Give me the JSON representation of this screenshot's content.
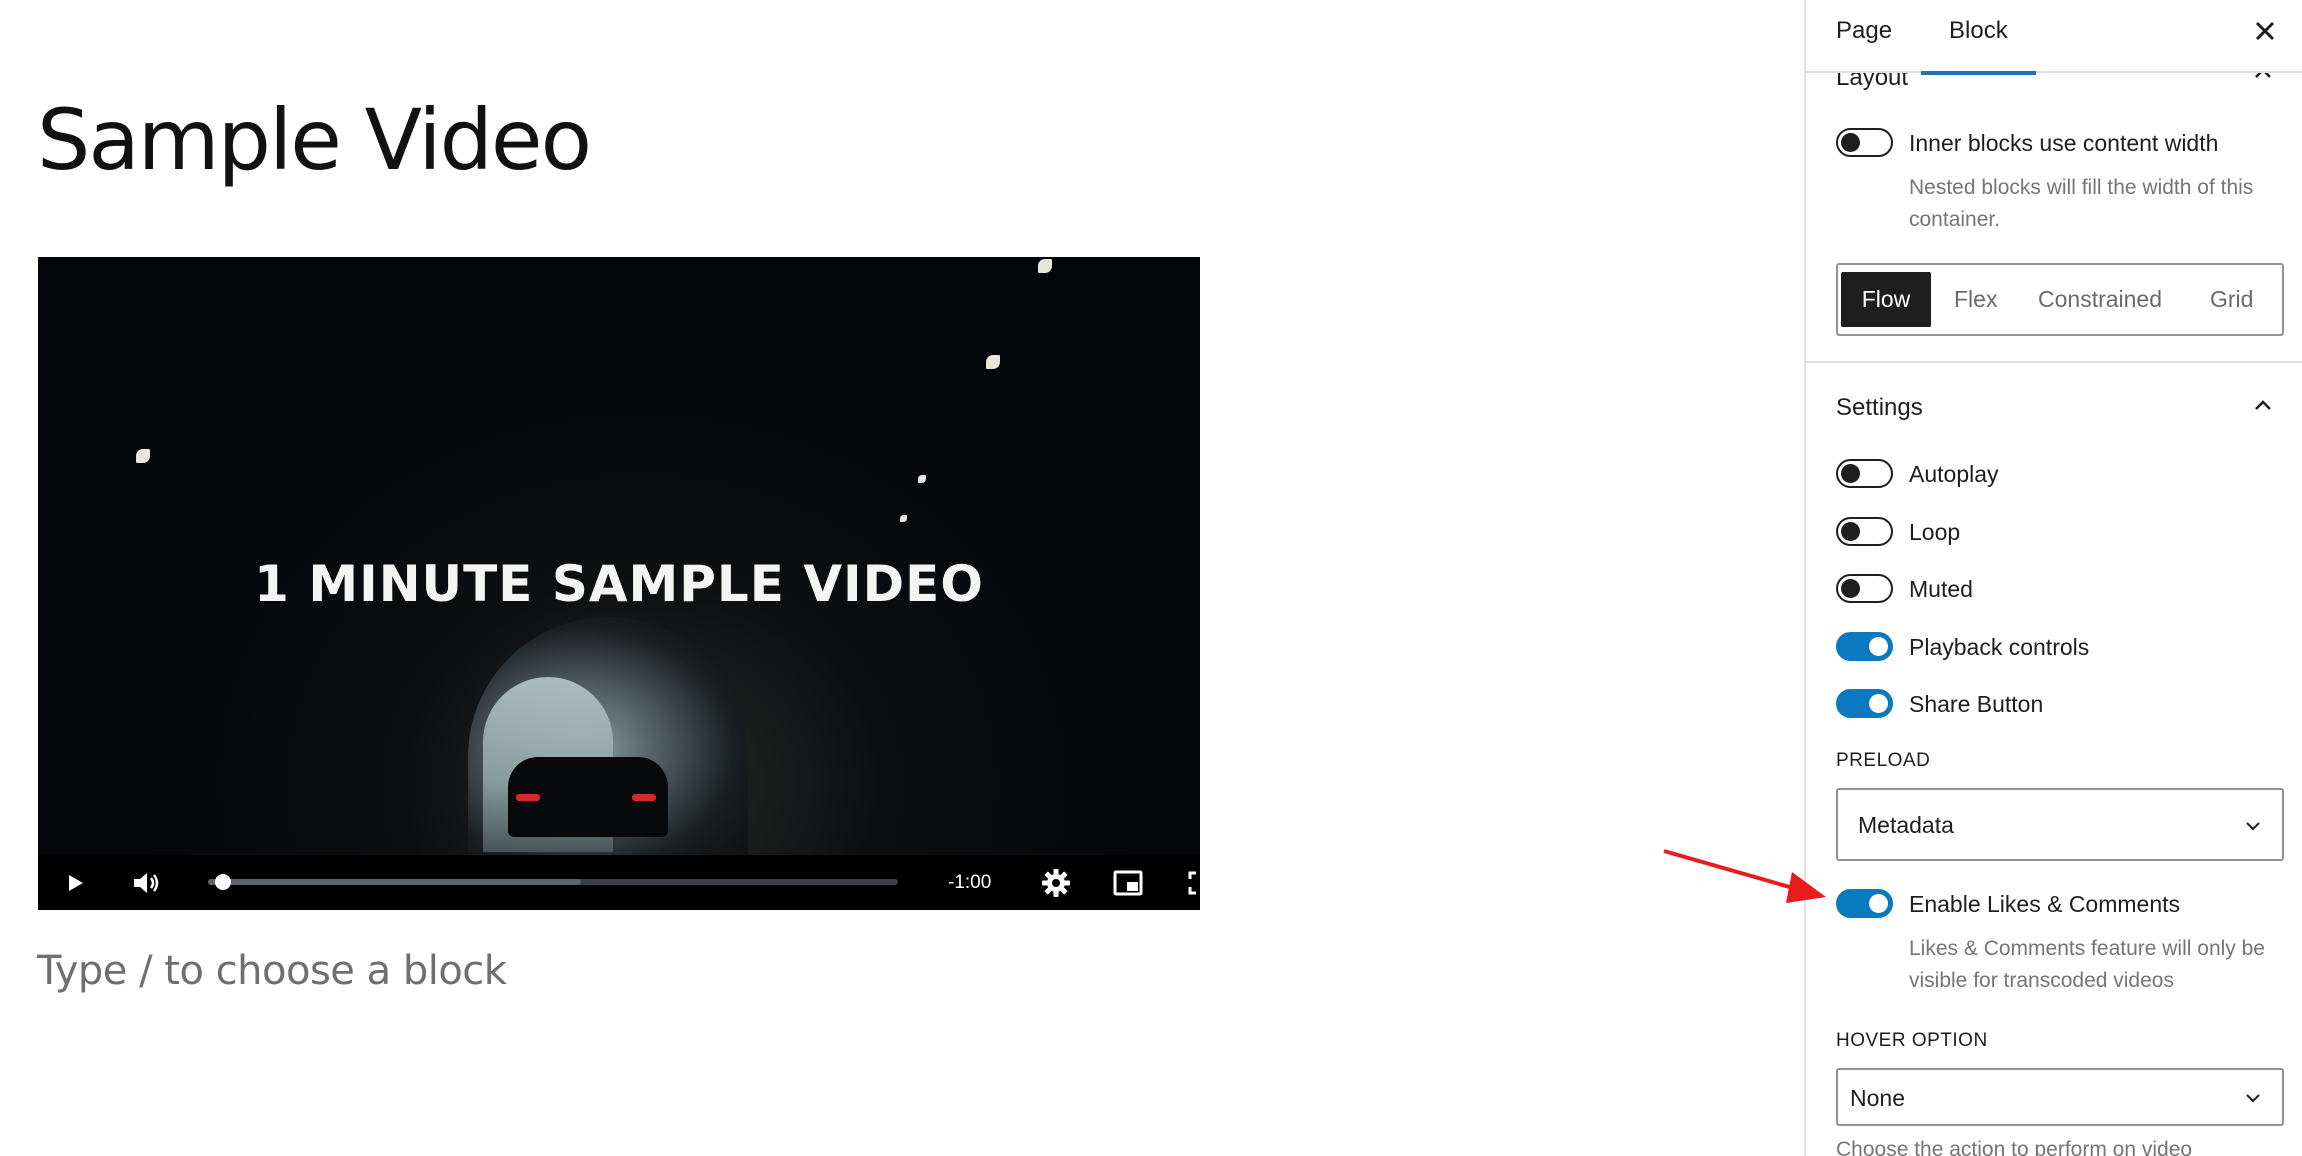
{
  "editor": {
    "title": "Sample Video",
    "video_caption": "1 MINUTE SAMPLE VIDEO",
    "time_remaining": "-1:00",
    "progress_fraction": 0.01,
    "buffered_fraction": 0.54,
    "block_placeholder": "Type / to choose a block"
  },
  "sidebar": {
    "tabs": [
      "Page",
      "Block"
    ],
    "active_tab": "Block",
    "layout": {
      "heading": "Layout",
      "inner_blocks_label": "Inner blocks use content width",
      "inner_blocks_on": false,
      "inner_blocks_help": "Nested blocks will fill the width of this container.",
      "options": [
        "Flow",
        "Flex",
        "Constrained",
        "Grid"
      ],
      "selected": "Flow"
    },
    "settings": {
      "heading": "Settings",
      "toggles": [
        {
          "label": "Autoplay",
          "on": false
        },
        {
          "label": "Loop",
          "on": false
        },
        {
          "label": "Muted",
          "on": false
        },
        {
          "label": "Playback controls",
          "on": true
        },
        {
          "label": "Share Button",
          "on": true
        }
      ],
      "preload_label": "PRELOAD",
      "preload_value": "Metadata",
      "likes_label": "Enable Likes & Comments",
      "likes_on": true,
      "likes_help": "Likes & Comments feature will only be visible for transcoded videos",
      "hover_label": "HOVER OPTION",
      "hover_value": "None",
      "hover_help_cutoff": "Choose the action to perform on video"
    }
  },
  "colors": {
    "accent": "#0a79c0",
    "tab_indicator": "#2271b1",
    "annotation_arrow": "#e81c1c"
  }
}
